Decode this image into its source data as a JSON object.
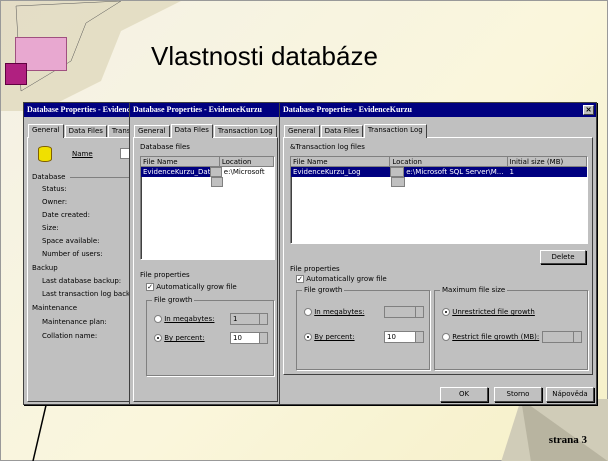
{
  "slide": {
    "title": "Vlastnosti databáze",
    "footer": "strana 3"
  },
  "win1": {
    "title": "Database Properties - EvidenceKurzu",
    "tabs": [
      "General",
      "Data Files",
      "Transaction Log"
    ],
    "name_label": "Name",
    "database_section": "Database",
    "database_fields": [
      "Status:",
      "Owner:",
      "Date created:",
      "Size:",
      "Space available:",
      "Number of users:"
    ],
    "backup_section": "Backup",
    "backup_fields": [
      "Last database backup:",
      "Last transaction log backup:"
    ],
    "maintenance_section": "Maintenance",
    "maintenance_fields": [
      "Maintenance plan:",
      "Collation name:"
    ]
  },
  "win2": {
    "title": "Database Properties - EvidenceKurzu",
    "tabs": [
      "General",
      "Data Files",
      "Transaction Log"
    ],
    "files_label": "Database files",
    "columns": [
      "File Name",
      "Location"
    ],
    "row_name": "EvidenceKurzu_Data",
    "row_location": "e:\\Microsoft",
    "file_properties": "File properties",
    "autogrow": "Automatically grow file",
    "file_growth": "File growth",
    "in_megabytes": "In megabytes:",
    "by_percent": "By percent:",
    "mb_value": "1",
    "percent_value": "10"
  },
  "win3": {
    "title": "Database Properties - EvidenceKurzu",
    "tabs": [
      "General",
      "Data Files",
      "Transaction Log"
    ],
    "files_label": "&Transaction log files",
    "columns": [
      "File Name",
      "Location",
      "Initial size (MB)"
    ],
    "row_name": "EvidenceKurzu_Log",
    "row_location": "e:\\Microsoft SQL Server\\M...",
    "row_size": "1",
    "delete_button": "Delete",
    "file_properties": "File properties",
    "autogrow": "Automatically grow file",
    "file_growth": "File growth",
    "in_megabytes": "In megabytes:",
    "by_percent": "By percent:",
    "mb_value": "",
    "percent_value": "10",
    "max_file_size": "Maximum file size",
    "unrestricted": "Unrestricted file growth",
    "restrict": "Restrict file growth (MB):",
    "restrict_value": "",
    "ok_button": "OK",
    "cancel_button": "Storno",
    "help_button": "Nápověda"
  },
  "colors": {
    "titlebar": "#000080",
    "window_bg": "#c0c0c0",
    "selection": "#000080"
  }
}
